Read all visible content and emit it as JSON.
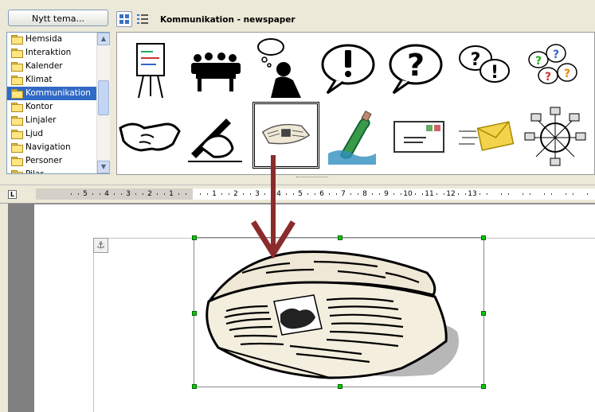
{
  "gallery": {
    "new_theme_button": "Nytt tema...",
    "title": "Kommunikation - newspaper",
    "themes": [
      {
        "label": "Hemsida",
        "selected": false
      },
      {
        "label": "Interaktion",
        "selected": false
      },
      {
        "label": "Kalender",
        "selected": false
      },
      {
        "label": "Klimat",
        "selected": false
      },
      {
        "label": "Kommunikation",
        "selected": true
      },
      {
        "label": "Kontor",
        "selected": false
      },
      {
        "label": "Linjaler",
        "selected": false
      },
      {
        "label": "Ljud",
        "selected": false
      },
      {
        "label": "Navigation",
        "selected": false
      },
      {
        "label": "Personer",
        "selected": false
      },
      {
        "label": "Pilar",
        "selected": false
      }
    ],
    "items_row1": [
      "flipchart-clipart",
      "meeting-clipart",
      "thinking-person-clipart",
      "exclamation-bubble-clipart",
      "question-bubble-clipart",
      "question-exclamation-bubbles-clipart",
      "colorful-question-bubbles-clipart"
    ],
    "items_row2": [
      "handshake-clipart",
      "writing-hand-clipart",
      "newspaper-clipart",
      "message-in-bottle-clipart",
      "envelope-stamps-clipart",
      "flying-envelope-clipart",
      "network-clipart"
    ],
    "selected_item": "newspaper-clipart"
  },
  "ruler": {
    "numbers_left": [
      "5",
      "4",
      "3",
      "2",
      "1"
    ],
    "numbers_right": [
      "1",
      "2",
      "3",
      "4",
      "5",
      "6",
      "7",
      "8",
      "9",
      "10",
      "11",
      "12",
      "13"
    ]
  },
  "colors": {
    "selection": "#316ac5",
    "drag_arrow": "#8b2b2b",
    "handle": "#00cc00",
    "chrome": "#ece9d8"
  },
  "icons": {
    "view_icons": "grid-view-icon",
    "view_details": "details-view-icon",
    "anchor": "anchor-icon",
    "drag": "drag-arrow-icon"
  }
}
